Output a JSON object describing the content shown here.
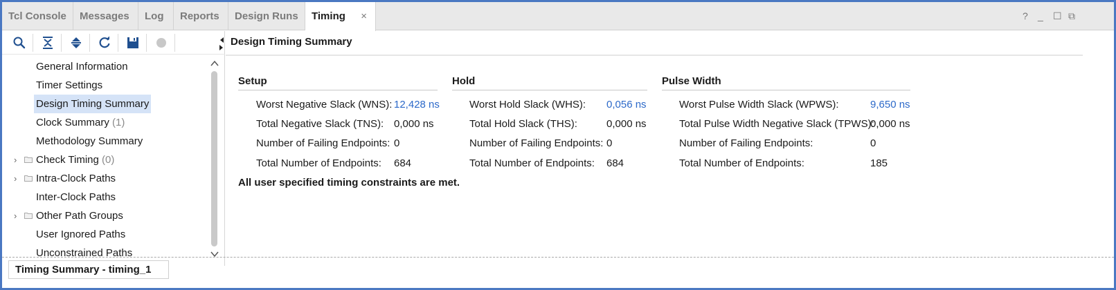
{
  "tabs": [
    {
      "label": "Tcl Console",
      "active": false
    },
    {
      "label": "Messages",
      "active": false
    },
    {
      "label": "Log",
      "active": false
    },
    {
      "label": "Reports",
      "active": false
    },
    {
      "label": "Design Runs",
      "active": false
    },
    {
      "label": "Timing",
      "active": true,
      "close": "×"
    }
  ],
  "window_controls": {
    "help": "?",
    "minimize": "_",
    "maximize": "☐",
    "restore": "⧉"
  },
  "toolbar": {
    "icons": [
      "search-icon",
      "collapse-all-icon",
      "expand-all-icon",
      "refresh-icon",
      "save-icon",
      "stop-icon"
    ]
  },
  "tree": {
    "items": [
      {
        "label": "General Information",
        "count": "",
        "expandable": false,
        "folder": false,
        "selected": false
      },
      {
        "label": "Timer Settings",
        "count": "",
        "expandable": false,
        "folder": false,
        "selected": false
      },
      {
        "label": "Design Timing Summary",
        "count": "",
        "expandable": false,
        "folder": false,
        "selected": true
      },
      {
        "label": "Clock Summary",
        "count": "(1)",
        "expandable": false,
        "folder": false,
        "selected": false
      },
      {
        "label": "Methodology Summary",
        "count": "",
        "expandable": false,
        "folder": false,
        "selected": false
      },
      {
        "label": "Check Timing",
        "count": "(0)",
        "expandable": true,
        "folder": true,
        "selected": false
      },
      {
        "label": "Intra-Clock Paths",
        "count": "",
        "expandable": true,
        "folder": true,
        "selected": false
      },
      {
        "label": "Inter-Clock Paths",
        "count": "",
        "expandable": false,
        "folder": false,
        "selected": false
      },
      {
        "label": "Other Path Groups",
        "count": "",
        "expandable": true,
        "folder": true,
        "selected": false
      },
      {
        "label": "User Ignored Paths",
        "count": "",
        "expandable": false,
        "folder": false,
        "selected": false
      },
      {
        "label": "Unconstrained Paths",
        "count": "",
        "expandable": false,
        "folder": false,
        "selected": false
      }
    ]
  },
  "main": {
    "title": "Design Timing Summary",
    "setup": {
      "heading": "Setup",
      "rows": [
        {
          "key": "Worst Negative Slack (WNS):",
          "value": "12,428 ns",
          "link": true
        },
        {
          "key": "Total Negative Slack (TNS):",
          "value": "0,000 ns",
          "link": false
        },
        {
          "key": "Number of Failing Endpoints:",
          "value": "0",
          "link": false
        },
        {
          "key": "Total Number of Endpoints:",
          "value": "684",
          "link": false
        }
      ]
    },
    "hold": {
      "heading": "Hold",
      "rows": [
        {
          "key": "Worst Hold Slack (WHS):",
          "value": "0,056 ns",
          "link": true
        },
        {
          "key": "Total Hold Slack (THS):",
          "value": "0,000 ns",
          "link": false
        },
        {
          "key": "Number of Failing Endpoints:",
          "value": "0",
          "link": false
        },
        {
          "key": "Total Number of Endpoints:",
          "value": "684",
          "link": false
        }
      ]
    },
    "pulse_width": {
      "heading": "Pulse Width",
      "rows": [
        {
          "key": "Worst Pulse Width Slack (WPWS):",
          "value": "9,650 ns",
          "link": true
        },
        {
          "key": "Total Pulse Width Negative Slack (TPWS):",
          "value": "0,000 ns",
          "link": false
        },
        {
          "key": "Number of Failing Endpoints:",
          "value": "0",
          "link": false
        },
        {
          "key": "Total Number of Endpoints:",
          "value": "185",
          "link": false
        }
      ]
    },
    "status_message": "All user specified timing constraints are met."
  },
  "bottom_tab": {
    "label": "Timing Summary - timing_1"
  },
  "colors": {
    "frame": "#4a78c2",
    "link": "#2c69c9",
    "selected_bg": "#d5e3f7"
  }
}
